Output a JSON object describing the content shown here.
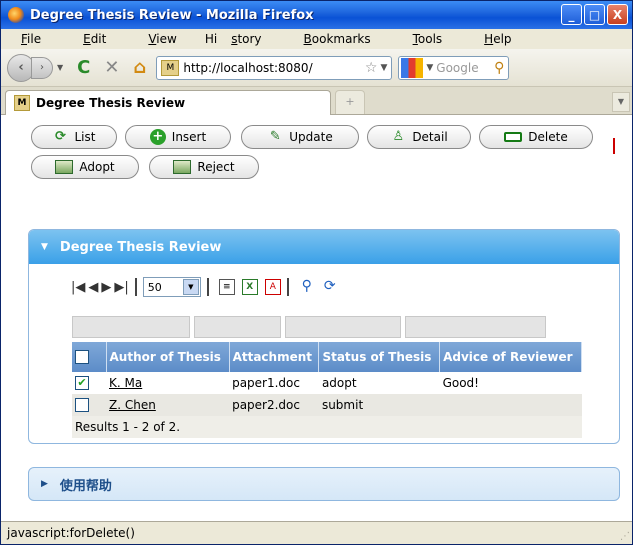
{
  "window": {
    "title": "Degree Thesis Review - Mozilla Firefox",
    "min": "_",
    "max": "□",
    "close": "X"
  },
  "menu": [
    {
      "pre": "",
      "key": "F",
      "post": "ile"
    },
    {
      "pre": "",
      "key": "E",
      "post": "dit"
    },
    {
      "pre": "",
      "key": "V",
      "post": "iew"
    },
    {
      "pre": "Hi",
      "key": "s",
      "post": "tory"
    },
    {
      "pre": "",
      "key": "B",
      "post": "ookmarks"
    },
    {
      "pre": "",
      "key": "T",
      "post": "ools"
    },
    {
      "pre": "",
      "key": "H",
      "post": "elp"
    }
  ],
  "nav": {
    "url": "http://localhost:8080/",
    "search_placeholder": "Google"
  },
  "tab": {
    "label": "Degree Thesis Review",
    "new_tab": "+"
  },
  "actions": {
    "list": "List",
    "insert": "Insert",
    "update": "Update",
    "detail": "Detail",
    "delete": "Delete",
    "adopt": "Adopt",
    "reject": "Reject"
  },
  "panel": {
    "title": "Degree Thesis Review"
  },
  "grid": {
    "page_size": "50",
    "columns": [
      "Author of Thesis",
      "Attachment",
      "Status of Thesis",
      "Advice of Reviewer"
    ],
    "rows": [
      {
        "checked": true,
        "author": "K. Ma",
        "attachment": "paper1.doc",
        "status": "adopt",
        "advice": "Good!"
      },
      {
        "checked": false,
        "author": "Z. Chen",
        "attachment": "paper2.doc",
        "status": "submit",
        "advice": ""
      }
    ],
    "footer": "Results 1 - 2 of 2."
  },
  "help": {
    "title": "使用帮助"
  },
  "status": {
    "text": "javascript:forDelete()"
  }
}
